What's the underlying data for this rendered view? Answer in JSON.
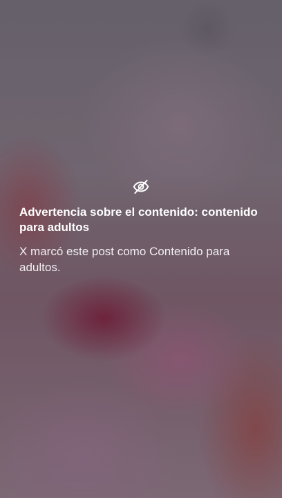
{
  "warning": {
    "icon": "eye-off-icon",
    "title": "Advertencia sobre el contenido: contenido para adultos",
    "description": "X marcó este post como Contenido para adultos."
  },
  "colors": {
    "text": "#ffffff"
  }
}
